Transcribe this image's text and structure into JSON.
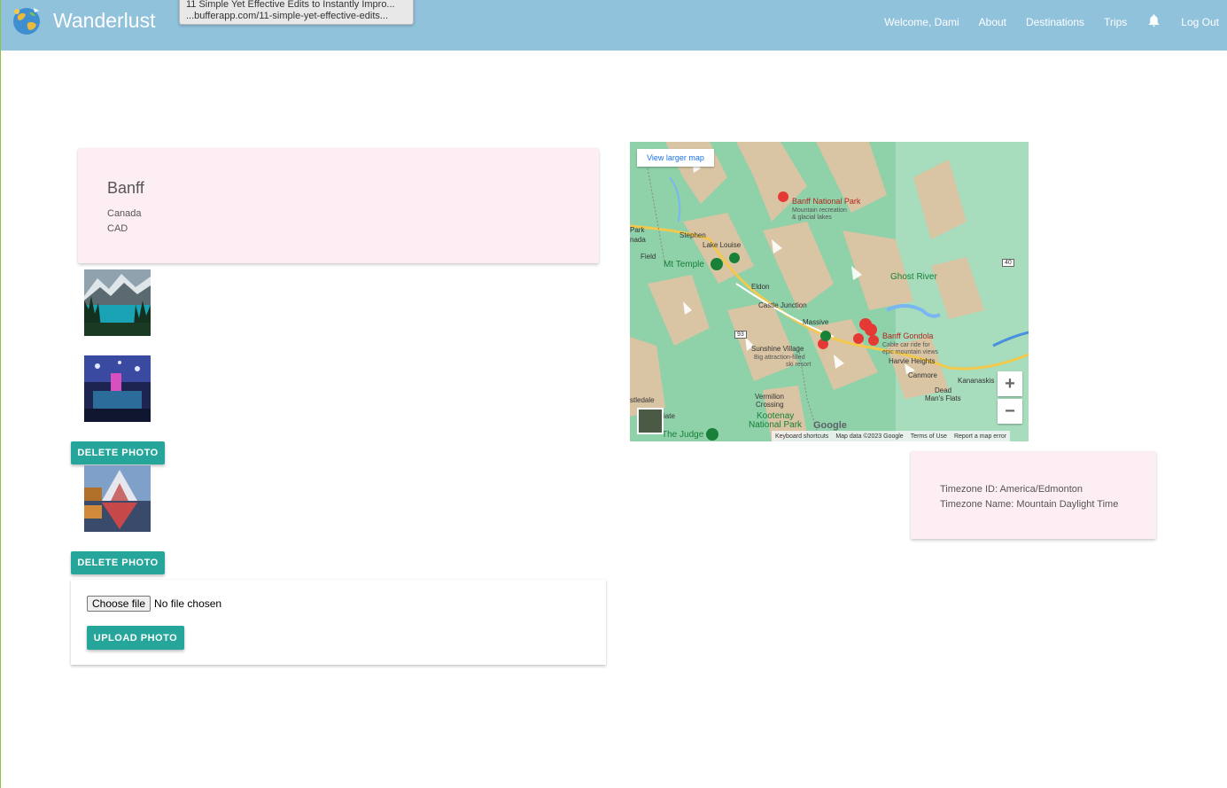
{
  "nav": {
    "brand": "Wanderlust",
    "welcome": "Welcome, Dami",
    "about": "About",
    "destinations": "Destinations",
    "trips": "Trips",
    "logout": "Log Out"
  },
  "tooltip": {
    "title": "11 Simple Yet Effective Edits to Instantly Impro...",
    "url": "...bufferapp.com/11-simple-yet-effective-edits..."
  },
  "destination": {
    "name": "Banff",
    "country": "Canada",
    "currency": "CAD"
  },
  "photos": {
    "delete_label": "DELETE PHOTO"
  },
  "upload": {
    "choose_label": "Choose file",
    "file_status": "No file chosen",
    "upload_label": "UPLOAD PHOTO"
  },
  "map": {
    "view_larger": "View larger map",
    "zoom_in": "+",
    "zoom_out": "−",
    "google": "Google",
    "footer": {
      "shortcuts": "Keyboard shortcuts",
      "data": "Map data ©2023 Google",
      "terms": "Terms of Use",
      "report": "Report a map error"
    },
    "places": {
      "banff_np": "Banff National Park",
      "banff_np_sub1": "Mountain recreation",
      "banff_np_sub2": "& glacial lakes",
      "park": "Park",
      "nada": "nada",
      "stephen": "Stephen",
      "lake_louise": "Lake Louise",
      "field": "Field",
      "mt_temple": "Mt Temple",
      "eldon": "Eldon",
      "castle_junction": "Castle Junction",
      "ghost_river": "Ghost River",
      "massive": "Massive",
      "banff_gondola": "Banff Gondola",
      "gondola_sub1": "Cable car ride for",
      "gondola_sub2": "epic mountain views",
      "harvie_heights": "Harvie Heights",
      "sunshine_village": "Sunshine Village",
      "sunshine_sub1": "Big attraction-filled",
      "sunshine_sub2": "ski resort",
      "canmore": "Canmore",
      "kananaskis": "Kananaskis",
      "dead_mans_flats_1": "Dead",
      "dead_mans_flats_2": "Man's Flats",
      "vermilion_1": "Vermilion",
      "vermilion_2": "Crossing",
      "kootenay_1": "Kootenay",
      "kootenay_2": "National Park",
      "astledale": "stledale",
      "iate": "iate",
      "the_judge": "The Judge",
      "hwy_40": "40",
      "hwy_93": "93"
    }
  },
  "timezone": {
    "id_line": "Timezone ID: America/Edmonton",
    "name_line": "Timezone Name: Mountain Daylight Time"
  }
}
